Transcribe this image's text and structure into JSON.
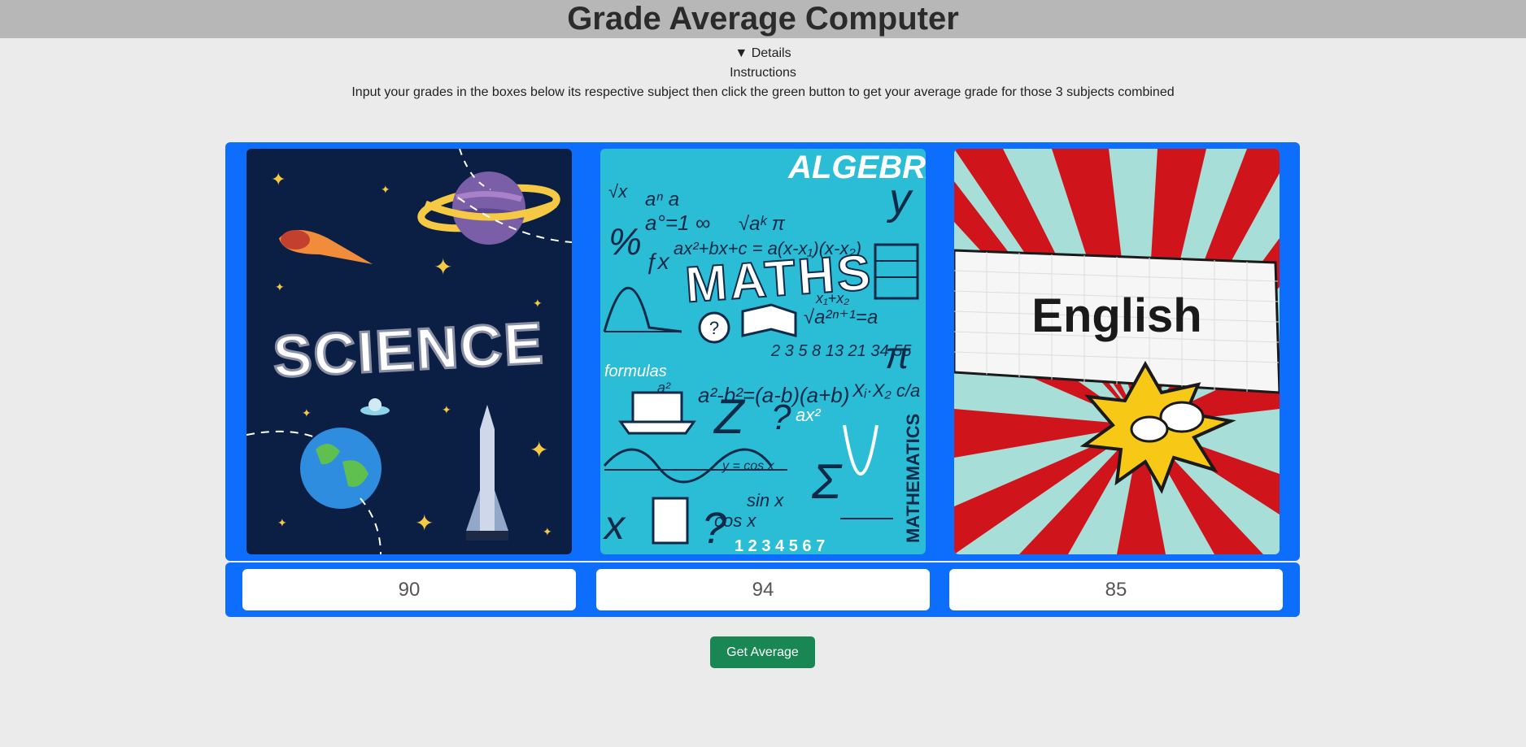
{
  "page": {
    "title": "Grade Average Computer"
  },
  "details": {
    "toggle_label": "▼ Details",
    "instructions_title": "Instructions",
    "instructions_text": "Input your grades in the boxes below its respective subject then click the green button to get your average grade for those 3 subjects combined"
  },
  "subjects": [
    {
      "image_text": "SCIENCE",
      "grade": "90"
    },
    {
      "image_text": "MATHS",
      "grade": "94"
    },
    {
      "image_text": "English",
      "grade": "85"
    }
  ],
  "math_cover": {
    "algebra": "ALGEBRA",
    "formulas": "formulas",
    "mathematics": "MATHEMATICS",
    "eq1": "ax²+bx+c = a(x-x₁)(x-x₂)",
    "eq2": "a²-b²=(a-b)(a+b)",
    "eq3": "2 3 5 8 13 21 34 55",
    "eq4": "1 2 3 4 5 6 7",
    "eq5": "√aᵏ π",
    "eq6": "y = cos x",
    "eq7": "sin x",
    "eq8": "cos x",
    "eq9": "ax²"
  },
  "button": {
    "label": "Get Average"
  },
  "colors": {
    "header_bg": "#b7b7b7",
    "page_bg": "#ebebeb",
    "panel_blue": "#0d6efd",
    "button_green": "#198754",
    "science_bg": "#0b1f45",
    "math_bg": "#2bbcd6",
    "english_red": "#d0141b"
  }
}
